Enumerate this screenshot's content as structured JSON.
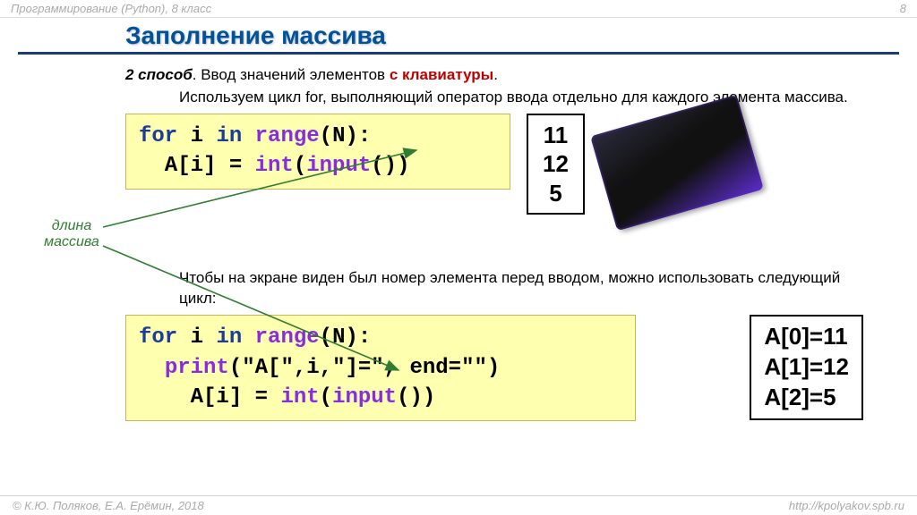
{
  "header": {
    "left": "Программирование (Python), 8 класс",
    "page": "8"
  },
  "title": "Заполнение массива",
  "intro": {
    "method_num": "2 способ",
    "method_rest": ". Ввод значений элементов ",
    "method_red": "с клавиатуры",
    "line2": "Используем цикл for, выполняющий оператор ввода отдельно для каждого элемента массива."
  },
  "code1": {
    "l1a": "for",
    "l1b": " i ",
    "l1c": "in",
    "l1d": " ",
    "l1e": "range",
    "l1f": "(N):",
    "l2a": "  A[i] = ",
    "l2b": "int",
    "l2c": "(",
    "l2d": "input",
    "l2e": "())"
  },
  "output1": {
    "v1": "11",
    "v2": "12",
    "v3": "5"
  },
  "label": {
    "l1": "длина",
    "l2": "массива"
  },
  "mid_text": "Чтобы на экране виден был номер элемента перед вводом, можно использовать следующий цикл:",
  "code2": {
    "l1a": "for",
    "l1b": " i ",
    "l1c": "in",
    "l1d": " ",
    "l1e": "range",
    "l1f": "(N):",
    "l2a": "  ",
    "l2b": "print",
    "l2c": "(",
    "l2d": "\"A[\"",
    "l2e": ",i,",
    "l2f": "\"]=\"",
    "l2g": ", end=",
    "l2h": "\"\"",
    "l2i": ")",
    "l3a": "    A[i] = ",
    "l3b": "int",
    "l3c": "(",
    "l3d": "input",
    "l3e": "())"
  },
  "output2": {
    "r1": "A[0]=11",
    "r2": "A[1]=12",
    "r3": "A[2]=5"
  },
  "footer": {
    "left": "© К.Ю. Поляков, Е.А. Ерёмин, 2018",
    "right": "http://kpolyakov.spb.ru"
  }
}
